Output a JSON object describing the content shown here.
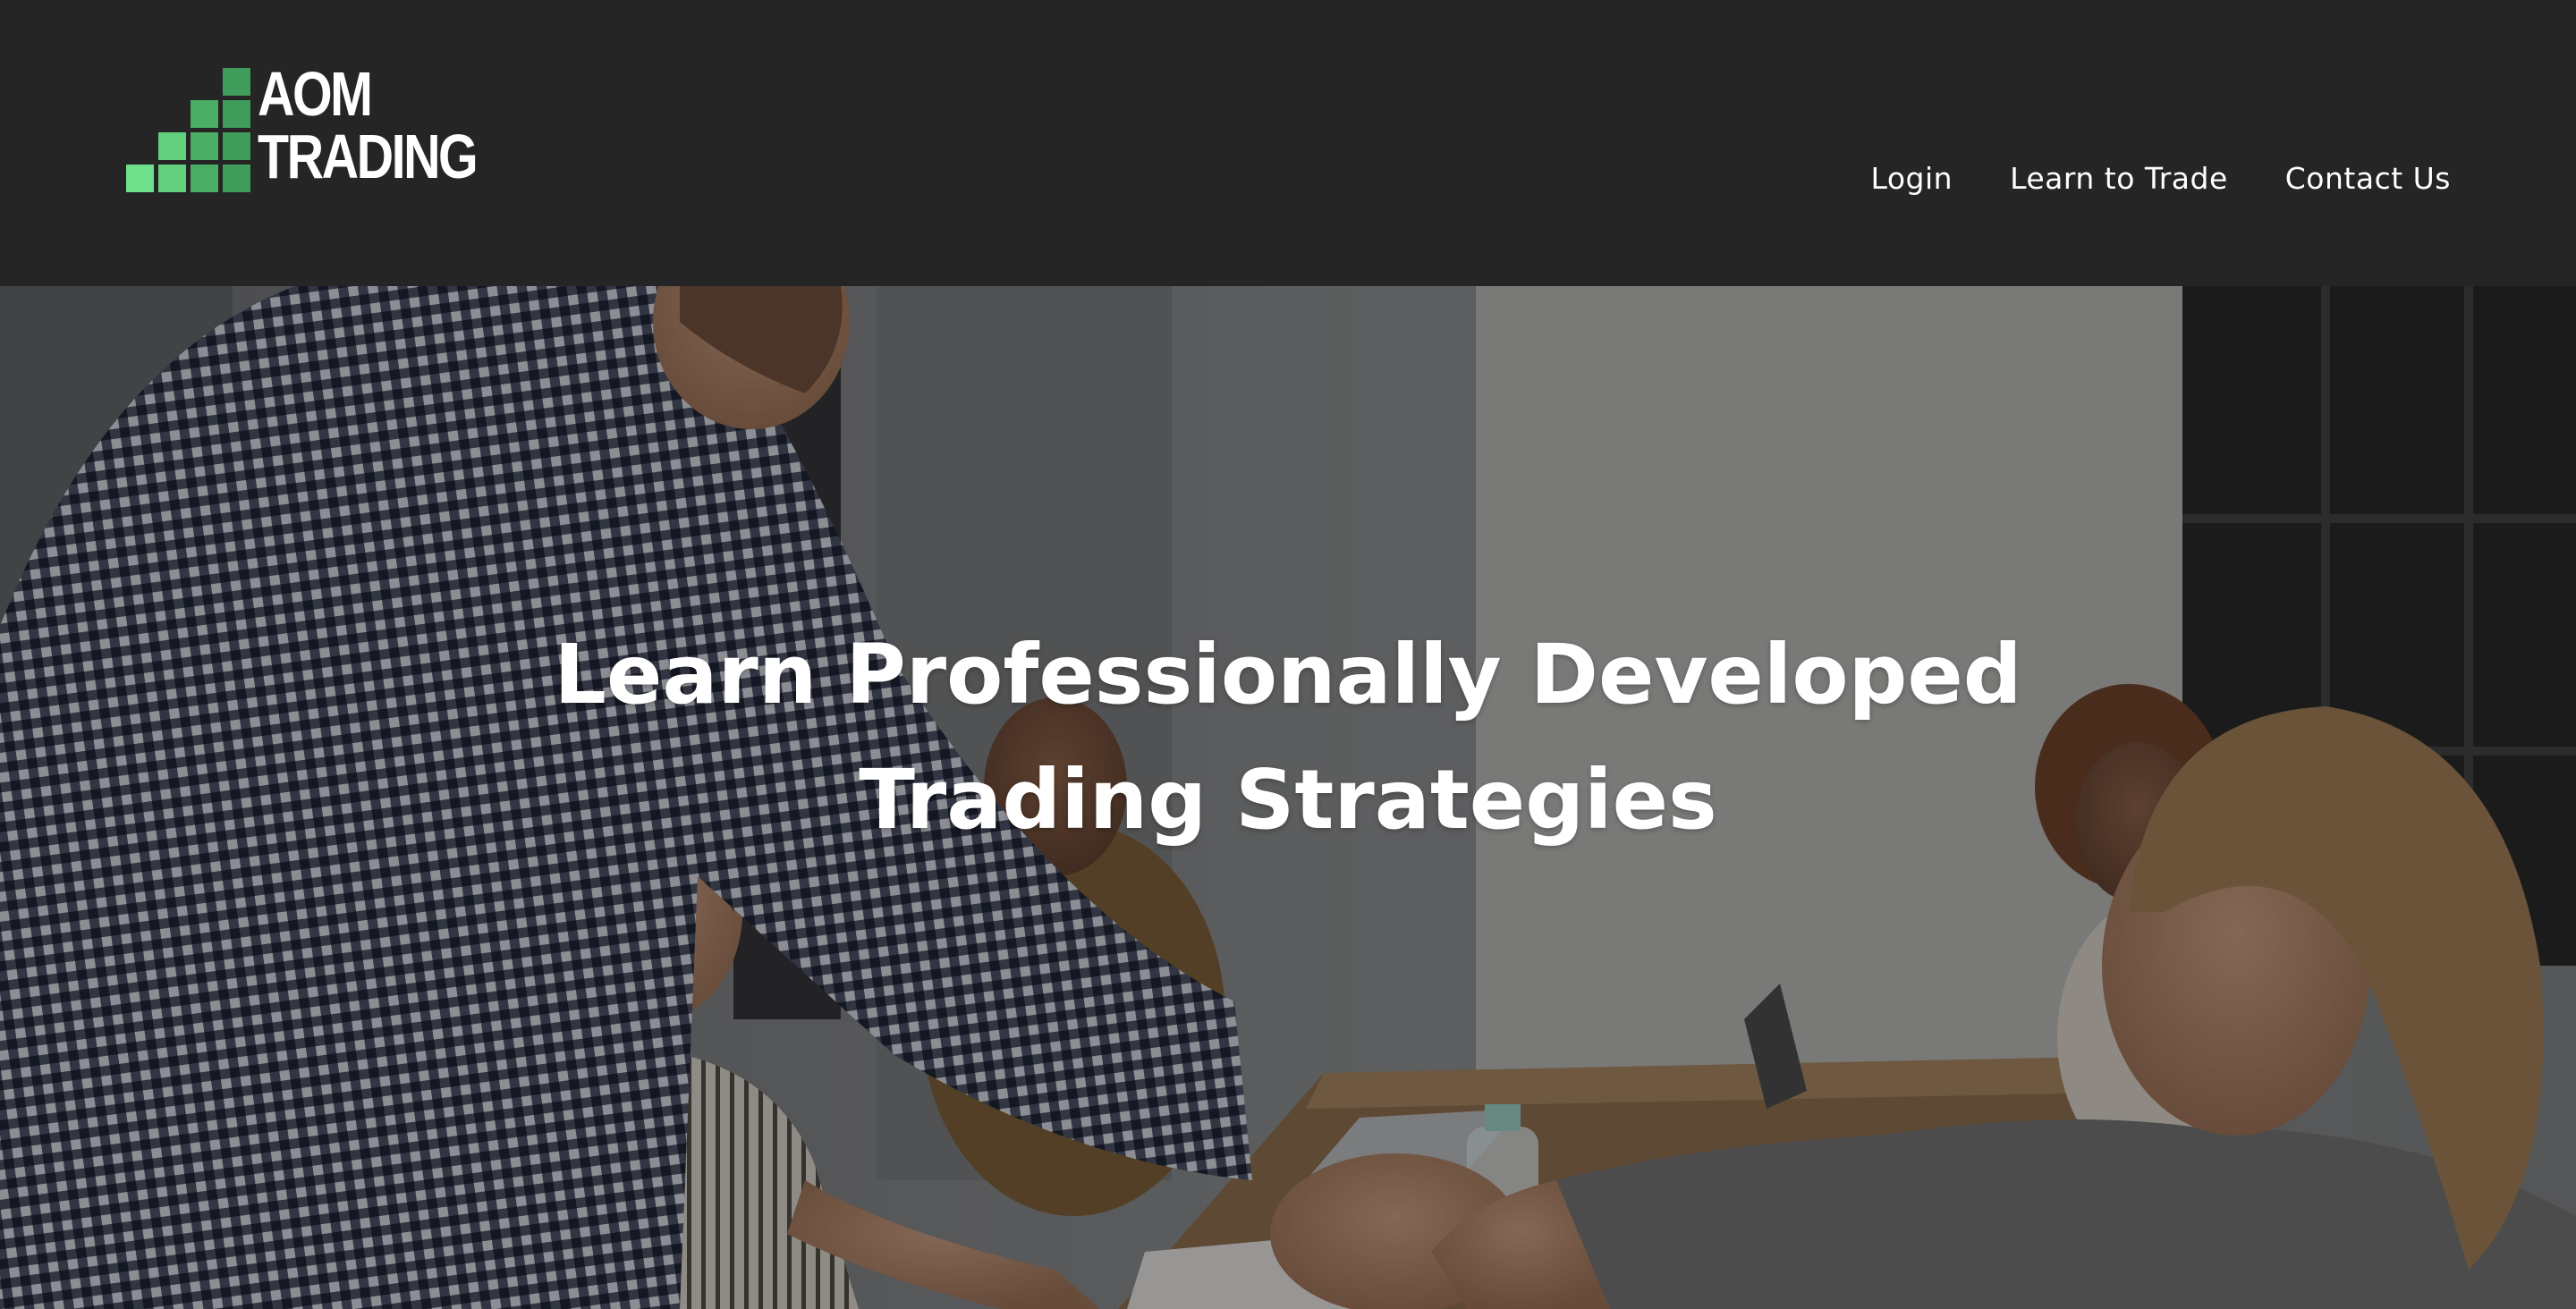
{
  "brand": {
    "line1": "AOM",
    "line2": "TRADING",
    "colors": {
      "square_dark": "#3f9c5a",
      "square_mid": "#4fb86b",
      "square_light": "#6ee08c"
    }
  },
  "nav": {
    "items": [
      {
        "label": "Login"
      },
      {
        "label": "Learn to Trade"
      },
      {
        "label": "Contact Us"
      }
    ]
  },
  "hero": {
    "title_line1": "Learn Professionally Developed",
    "title_line2": "Trading Strategies"
  },
  "colors": {
    "header_bg": "#252525",
    "text": "#ffffff"
  }
}
